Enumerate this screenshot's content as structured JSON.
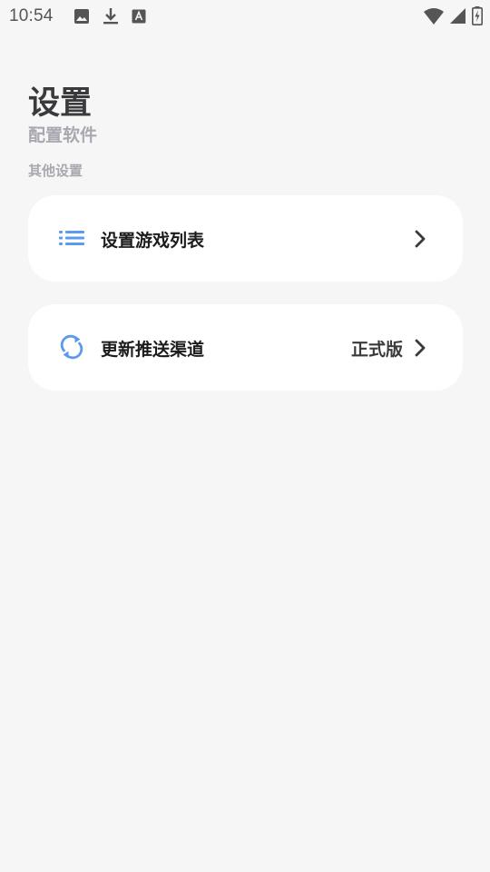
{
  "status_bar": {
    "time": "10:54",
    "left_icons": [
      "image-icon",
      "download-icon",
      "text-icon"
    ],
    "right_icons": [
      "wifi-icon",
      "signal-icon",
      "battery-charging-icon"
    ]
  },
  "header": {
    "title": "设置",
    "subtitle": "配置软件"
  },
  "section": {
    "label": "其他设置"
  },
  "items": [
    {
      "icon": "list-icon",
      "label": "设置游戏列表",
      "value": ""
    },
    {
      "icon": "refresh-icon",
      "label": "更新推送渠道",
      "value": "正式版"
    }
  ],
  "colors": {
    "background": "#f6f6f6",
    "card": "#ffffff",
    "accent_icon": "#5b9af0",
    "title": "#3a3a3c",
    "muted": "#a8a8b0"
  }
}
